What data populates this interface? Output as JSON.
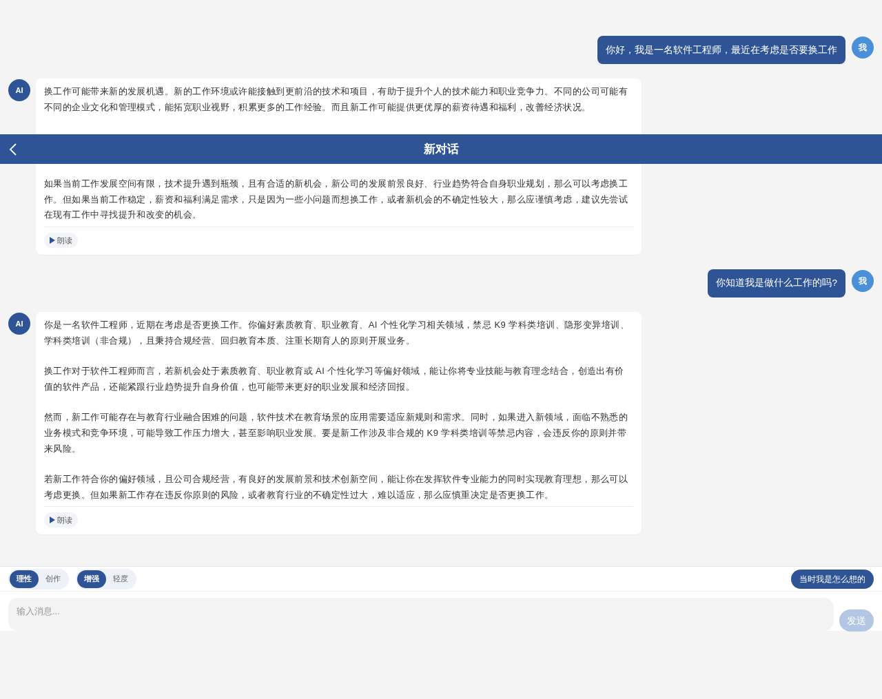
{
  "header": {
    "title": "新对话"
  },
  "messages": [
    {
      "kind": "user",
      "avatar": "我",
      "text": "你好，我是一名软件工程师，最近在考虑是否要换工作"
    },
    {
      "kind": "ai",
      "avatar": "AI",
      "covered_gap": true,
      "paragraphs": [
        "换工作可能带来新的发展机遇。新的工作环境或许能接触到更前沿的技术和项目，有助于提升个人的技术能力和职业竞争力。不同的公司可能有不同的企业文化和管理模式，能拓宽职业视野，积累更多的工作经验。而且新工作可能提供更优厚的薪资待遇和福利，改善经济状况。",
        "如果当前工作发展空间有限，技术提升遇到瓶颈，且有合适的新机会，新公司的发展前景良好、行业趋势符合自身职业规划，那么可以考虑换工作。但如果当前工作稳定，薪资和福利满足需求，只是因为一些小问题而想换工作，或者新机会的不确定性较大，那么应谨慎考虑，建议先尝试在现有工作中寻找提升和改变的机会。"
      ],
      "read_button": "朗读"
    },
    {
      "kind": "user",
      "avatar": "我",
      "text": "你知道我是做什么工作的吗?"
    },
    {
      "kind": "ai",
      "avatar": "AI",
      "covered_gap": false,
      "paragraphs": [
        "你是一名软件工程师，近期在考虑是否更换工作。你偏好素质教育、职业教育、AI 个性化学习相关领域，禁忌 K9 学科类培训、隐形变异培训、学科类培训（非合规），且秉持合规经营、回归教育本质、注重长期育人的原则开展业务。",
        "换工作对于软件工程师而言，若新机会处于素质教育、职业教育或 AI 个性化学习等偏好领域，能让你将专业技能与教育理念结合，创造出有价值的软件产品，还能紧跟行业趋势提升自身价值，也可能带来更好的职业发展和经济回报。",
        "然而，新工作可能存在与教育行业融合困难的问题，软件技术在教育场景的应用需要适应新规则和需求。同时，如果进入新领域，面临不熟悉的业务模式和竞争环境，可能导致工作压力增大，甚至影响职业发展。要是新工作涉及非合规的 K9 学科类培训等禁忌内容，会违反你的原则并带来风险。",
        "若新工作符合你的偏好领域，且公司合规经营，有良好的发展前景和技术创新空间，能让你在发挥软件专业能力的同时实现教育理想，那么可以考虑更换。但如果新工作存在违反你原则的风险，或者教育行业的不确定性过大，难以适应，那么应慎重决定是否更换工作。"
      ],
      "read_button": "朗读"
    }
  ],
  "mode_groups": [
    [
      {
        "label": "理性",
        "selected": true
      },
      {
        "label": "创作",
        "selected": false
      }
    ],
    [
      {
        "label": "增强",
        "selected": true
      },
      {
        "label": "轻度",
        "selected": false
      }
    ]
  ],
  "recall_button": "当时我是怎么想的",
  "input": {
    "placeholder": "输入消息..."
  },
  "send_button": {
    "label": "发送",
    "disabled": true
  }
}
